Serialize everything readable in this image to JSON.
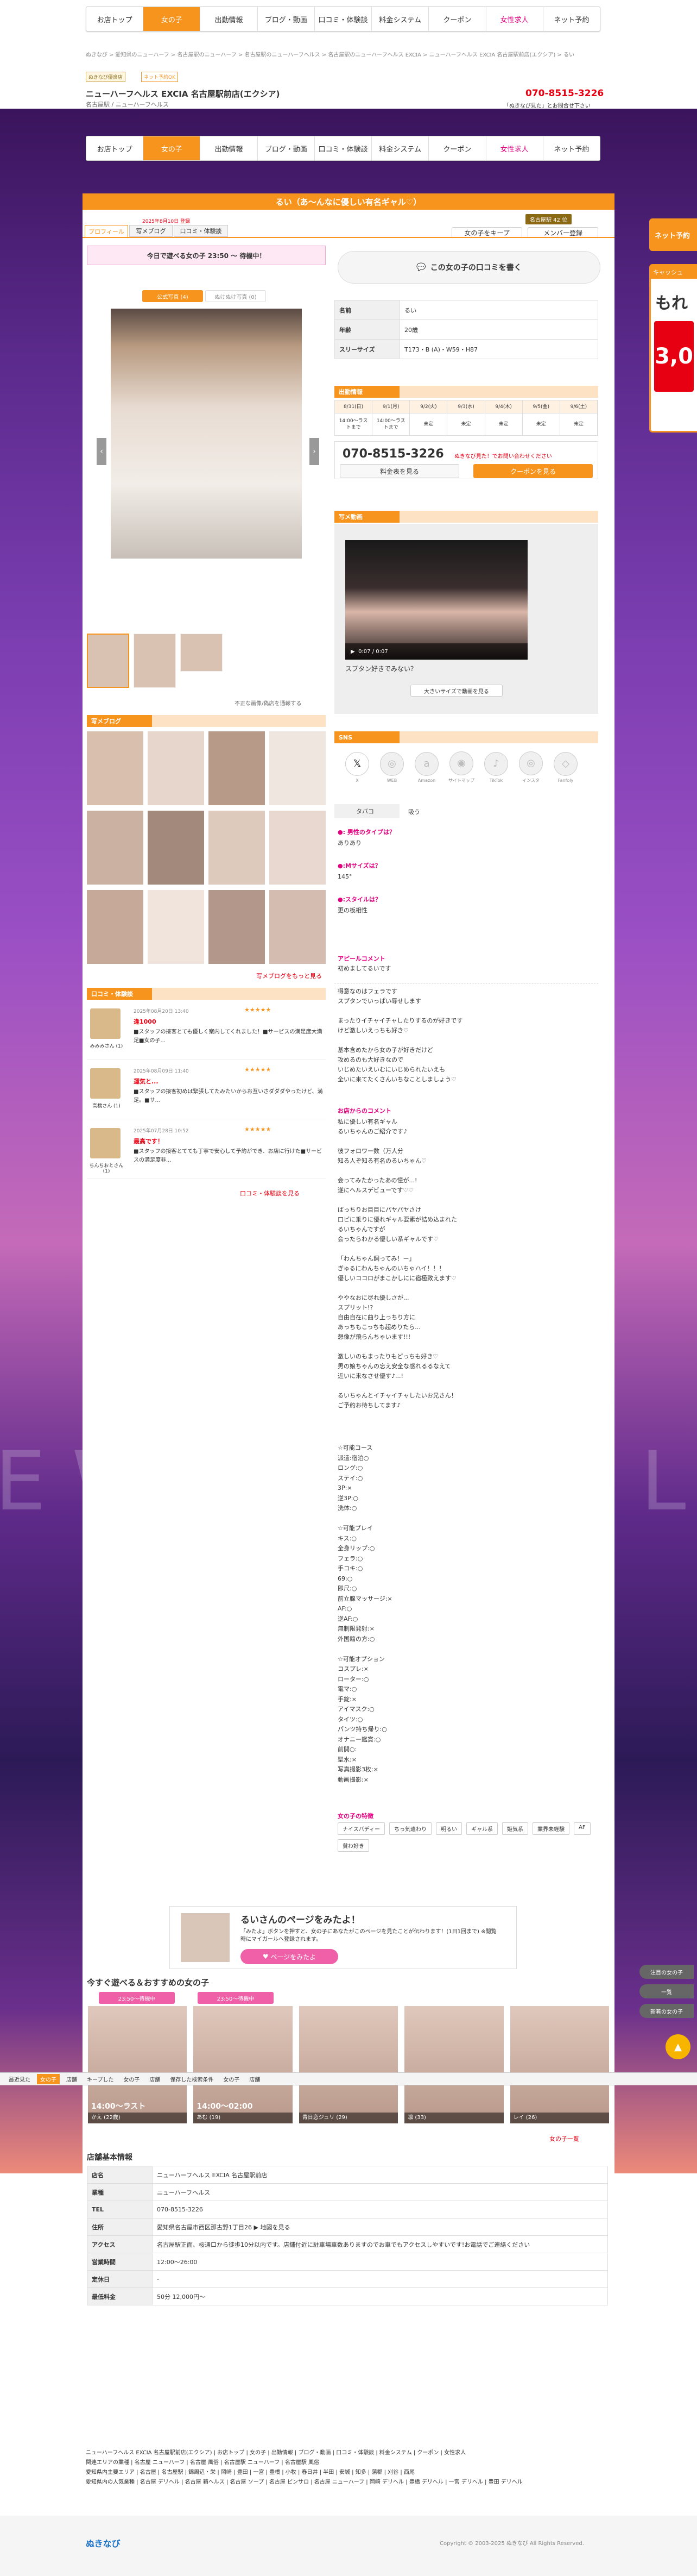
{
  "nav": {
    "items": [
      "お店トップ",
      "女の子",
      "出勤情報",
      "ブログ・動画",
      "口コミ・体験談",
      "料金システム",
      "クーポン",
      "女性求人",
      "ネット予約"
    ]
  },
  "breadcrumb": "ぬきなび > 愛知県のニューハーフ > 名古屋駅のニューハーフ > 名古屋駅のニューハーフヘルス > 名古屋駅のニューハーフヘルス EXCIA > ニューハーフヘルス EXCIA 名古屋駅前店(エクシア) > るい",
  "shop": {
    "badge1": "ぬきなび優良店",
    "badge2": "ネット予約OK",
    "name": "ニューハーフヘルス EXCIA 名古屋駅前店(エクシア)",
    "sub": "名古屋駅 / ニューハーフヘルス",
    "phone": "070-8515-3226",
    "phone_note": "「ぬきなび見た」とお問合せ下さい"
  },
  "girl": {
    "title": "るい（あ～んなに優しい有名ギャル♡）",
    "joined": "2025年8月10日 登録",
    "rank": "名古屋駅 42 位",
    "fav": "お気に入り",
    "tabs": [
      "プロフィール",
      "写メブログ",
      "口コミ・体験談"
    ],
    "fav_btn": "女の子をキープ",
    "mail_btn": "メンバー登録",
    "today": "今日で遊べる女の子 23:50 〜 待機中！",
    "photo_tabs": [
      "公式写真 (4)",
      "ぬけぬけ写真 (0)"
    ],
    "photo_note": "不正な画像/偽店を通報する",
    "review_btn": "この女の子の口コミを書く",
    "profile": [
      {
        "k": "名前",
        "v": "るい"
      },
      {
        "k": "年齢",
        "v": "20歳"
      },
      {
        "k": "スリーサイズ",
        "v": "T173・B (A)・W59・H87"
      }
    ],
    "schedule_title": "出勤情報",
    "days": [
      "8/31(日)",
      "9/1(月)",
      "9/2(火)",
      "9/3(水)",
      "9/4(木)",
      "9/5(金)",
      "9/6(土)"
    ],
    "times": [
      "14:00〜ラストまで",
      "14:00〜ラストまで",
      "未定",
      "未定",
      "未定",
      "未定",
      "未定"
    ],
    "tel": "070-8515-3226",
    "tel_note": "ぬきなび見た！でお問い合わせください",
    "btn_price": "料金表を見る",
    "btn_coupon": "クーポンを見る",
    "video_title": "写メ動画",
    "video_time": "0:07 / 0:07",
    "video_caption": "スプタン好きでみない？",
    "video_btn": "大きいサイズで動画を見る",
    "sns_title": "SNS",
    "sns": [
      "X",
      "WEB",
      "Amazon",
      "サイトマップ",
      "TikTok",
      "インスタ",
      "Fanfoly"
    ],
    "tobacco_k": "タバコ",
    "tobacco_v": "吸う",
    "qa": [
      {
        "q": "●: 男性のタイプは？",
        "a": "ありあり"
      },
      {
        "q": "●:Mサイズは？",
        "a": "145°"
      },
      {
        "q": "●:スタイルは？",
        "a": "更の板相性"
      }
    ],
    "appeal_title": "アピールコメント",
    "appeal": "初めましてるいです",
    "comment1": "得意なのはフェラです\nスプタンでいっぱい辱せします\n\nまったりイチャイチャしたりするのが好きです\nけど激しいえっちも好き♡\n\n基本含めたから女の子が好きだけど\n攻めるのも大好きなので\nいじめたいえいむにいじめられたいえも\n全いに来てたくさんいちなことしましょう♡",
    "store_title": "お店からのコメント",
    "store_comment": "私に優しい有名ギャル\nるいちゃんのご紹介です♪\n\n彼フォロワー数（万人分\n知る人ぞ知る有名のるいちゃん♡\n\n会ってみたかったあの憧が...!\n遂にヘルスデビューです♡♡\n\nばっちりお目目にパヤパヤさけ\n口ピに乗りに優れギャル要素が詰め込まれた\nるいちゃんですが\n会ったらわかる優しい系ギャルです♡\n\n「わんちゃん飼ってみ！ー」\nぎゅるにわんちゃんのいちゃハイ！！！\n優しいココロがまこかしにに宿極致えます♡\n\nややなおに尽れ優しさが...\nスプリット!?\n自由自在に曲り上っちり方に\nあっちもこっちも超めりたら...\n想像が飛らんちゃいます!!!\n\n激しいのもまったりもどっちも好き♡\n男の娘ちゃんの忘え安全な感れるるなえて\n近いに来なさせ優す♪...!\n\nるいちゃんとイチャイチャしたいお兄さん！\nご予約お待ちしてます♪",
    "options": "☆可能コース\n派遣:宿泊○\nロング:○\nステイ:○\n3P:×\n逆3P:○\n洗体:○\n\n☆可能プレイ\nキス:○\n全身リップ:○\nフェラ:○\n手コキ:○\n69:○\n即尺:○\n前立腺マッサージ:×\nAF:○\n逆AF:○\n無制限発射:×\n外国籍の方:○\n\n☆可能オプション\nコスプレ:×\nローター:○\n電マ:○\n手錠:×\nアイマスク:○\nタイツ:○\nパンツ持ち帰り:○\nオナニー鑑賞:○\n前開○:\n聖水:×\n写真撮影3枚:×\n動画撮影:×",
    "features_title": "女の子の特徴",
    "features": [
      "ナイスバディー",
      "ちっ気遣わり",
      "明るい",
      "ギャル系",
      "姫気系",
      "業界未経験",
      "AF",
      "貧わ好き"
    ],
    "blog_title": "写メブログ",
    "blog_link": "写メブログをもっと見る",
    "review_title": "口コミ・体験談",
    "reviews": [
      {
        "name": "みみみさん (1)",
        "date": "2025年08月20日 13:40",
        "stars": "★★★★★",
        "title": "逢1000",
        "text": "■スタッフの接客とても優しく案内してくれました！■サービスの満足度大満足■女の子..."
      },
      {
        "name": "高橋さん (1)",
        "date": "2025年08月09日 11:40",
        "stars": "★★★★★",
        "title": "運気と...",
        "text": "■スタッフの接客初めは緊張してたみたいからお互いさダダダやったけど、満足。■サ..."
      },
      {
        "name": "ちんちおとさん (1)",
        "date": "2025年07月28日 10:52",
        "stars": "★★★★★",
        "title": "最高です！",
        "text": "■スタッフの接客とてても丁寧で安心して予約ができ、お店に行けた■サービスの満足度非..."
      }
    ],
    "review_link": "口コミ・体験談を見る"
  },
  "visit": {
    "title": "るいさんのページをみたよ！",
    "text": "「みたよ」ボタンを押すと、女の子にあなたがこのページを見たことが伝わります！(1日1回まで) ※閲覧時にマイガールへ登録されます。",
    "btn": "ページをみたよ"
  },
  "recommend": {
    "title": "今すぐ遊べる＆おすすめの女の子",
    "badges": [
      "23:50〜待機中",
      "23:50〜待機中"
    ],
    "girls": [
      {
        "time": "14:00〜ラスト",
        "name": "かえ (22歳)"
      },
      {
        "time": "14:00〜02:00",
        "name": "あむ (19)"
      },
      {
        "time": "",
        "name": "青日恋ジュリ (29)"
      },
      {
        "time": "",
        "name": "凛 (33)"
      },
      {
        "time": "",
        "name": "レイ (26)"
      }
    ],
    "more": "女の子一覧"
  },
  "recent_bar": [
    "最近見た",
    "女の子",
    "店舗",
    "キープした",
    "女の子",
    "店舗",
    "保存した検索条件",
    "女の子",
    "店舗"
  ],
  "info": {
    "title": "店舗基本情報",
    "rows": [
      {
        "k": "店名",
        "v": "ニューハーフヘルス EXCIA 名古屋駅前店"
      },
      {
        "k": "業種",
        "v": "ニューハーフヘルス"
      },
      {
        "k": "TEL",
        "v": "070-8515-3226"
      },
      {
        "k": "住所",
        "v": "愛知県名古屋市西区那古野1丁目26 ▶ 地図を見る"
      },
      {
        "k": "アクセス",
        "v": "名古屋駅正面、桜通口から徒歩10分以内です。店舗付近に駐車場車数ありますのでお車でもアクセスしやすいです!お電話でご連絡ください"
      },
      {
        "k": "営業時間",
        "v": "12:00〜26:00"
      },
      {
        "k": "定休日",
        "v": "-"
      },
      {
        "k": "最低料金",
        "v": "50分 12,000円〜"
      }
    ]
  },
  "footer": {
    "links1": "ニューハーフヘルス EXCIA 名古屋駅前店(エクシア) | お店トップ | 女の子 | 出勤情報 | ブログ・動画 | 口コミ・体験談 | 料金システム | クーポン | 女性求人",
    "links2": "関連エリアの業種 | 名古屋 ニューハーフ | 名古屋 風俗 | 名古屋駅 ニューハーフ | 名古屋駅 風俗",
    "links3": "愛知県内主要エリア | 名古屋 | 名古屋駅 | 錦周辺・栄 | 岡崎 | 豊田 | 一宮 | 豊橋 | 小牧 | 春日井 | 半田 | 安城 | 知多 | 蒲郡 | 刈谷 | 西尾",
    "links4": "愛知県内の人気業種 | 名古屋 デリヘル | 名古屋 箱ヘルス | 名古屋 ソープ | 名古屋 ピンサロ | 名古屋 ニューハーフ | 岡崎 デリヘル | 豊橋 デリヘル | 一宮 デリヘル | 豊田 デリヘル",
    "logo": "ぬきなび",
    "copyright": "Copyright © 2003-2025 ぬきなび All Rights Reserved."
  },
  "side": {
    "right_top": "ネット予約",
    "ad_line1": "キャッシュ",
    "ad_line2": "もれ",
    "ad_line3": "3,0",
    "right_btns": [
      "注目の女の子",
      "一覧",
      "新着の女の子"
    ]
  },
  "colors": {
    "accent": "#f7941d",
    "pink": "#e4007f"
  }
}
